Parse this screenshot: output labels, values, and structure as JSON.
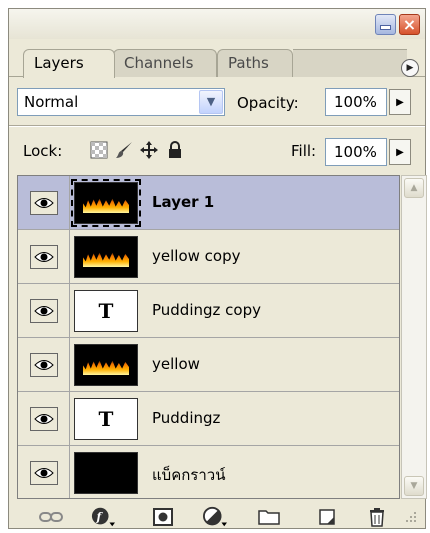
{
  "tabs": [
    {
      "label": "Layers",
      "active": true
    },
    {
      "label": "Channels",
      "active": false
    },
    {
      "label": "Paths",
      "active": false
    }
  ],
  "blend": {
    "mode": "Normal"
  },
  "opacity": {
    "label": "Opacity:",
    "value": "100%"
  },
  "lock": {
    "label": "Lock:",
    "icons": [
      "lock-transparent-icon",
      "lock-brush-icon",
      "lock-move-icon",
      "lock-all-icon"
    ]
  },
  "fill": {
    "label": "Fill:",
    "value": "100%"
  },
  "layers": [
    {
      "name": "Layer 1",
      "thumb": "fire",
      "selected": true
    },
    {
      "name": "yellow copy",
      "thumb": "fire",
      "selected": false
    },
    {
      "name": "Puddingz copy",
      "thumb": "text",
      "thumb_glyph": "T",
      "selected": false
    },
    {
      "name": "yellow",
      "thumb": "fire",
      "selected": false
    },
    {
      "name": "Puddingz",
      "thumb": "text",
      "thumb_glyph": "T",
      "selected": false
    },
    {
      "name": "แบ็คกราวน์",
      "thumb": "black",
      "selected": false
    }
  ],
  "bottom_icons": [
    "link-icon",
    "layer-style-icon",
    "mask-icon",
    "adjustment-icon",
    "folder-icon",
    "new-layer-icon",
    "trash-icon"
  ],
  "colors": {
    "selected_row": "#b9bdd9",
    "panel_bg": "#ece9d8",
    "close_button": "#d6522c",
    "minimize_button": "#a6b7df"
  }
}
